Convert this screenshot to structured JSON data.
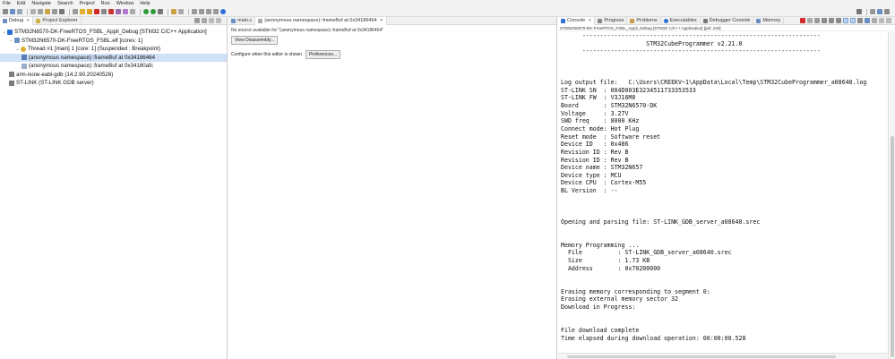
{
  "menu": [
    "File",
    "Edit",
    "Navigate",
    "Search",
    "Project",
    "Run",
    "Window",
    "Help"
  ],
  "left": {
    "tabs": [
      {
        "label": "Debug",
        "close": "✕"
      },
      {
        "label": "Project Explorer"
      }
    ],
    "tree": [
      "STM32N6570-DK-FreeRTOS_FSBL_Appli_Debug [STM32 C/C++ Application]",
      "STM32N6570-DK-FreeRTOS_FSBL.elf [cores: 1]",
      "Thread #1 [main] 1 [core: 1] (Suspended : Breakpoint)",
      "(anonymous namespace)::frameBuf at 0x34186464",
      "(anonymous namespace)::frameBuf at 0x34180afc",
      "arm-none-eabi-gdb (14.2.90.20240526)",
      "ST-LINK (ST-LINK GDB server)"
    ]
  },
  "editor": {
    "tabs": [
      {
        "label": "main.c"
      },
      {
        "label": "(anonymous namespace)::frameBuf at 0x34186464",
        "close": "✕"
      }
    ],
    "message": "No source available for \"(anonymous namespace)::frameBuf at 0x34186464\"",
    "view_disassembly": "View Disassembly...",
    "configure_text": "Configure when this editor is shown",
    "preferences": "Preferences..."
  },
  "console": {
    "tabs": [
      {
        "label": "Console",
        "close": "✕"
      },
      {
        "label": "Progress"
      },
      {
        "label": "Problems"
      },
      {
        "label": "Executables"
      },
      {
        "label": "Debugger Console"
      },
      {
        "label": "Memory"
      }
    ],
    "subtitle": "STM32N6570-DK-FreeRTOS_FSBL_Appli_Debug [STM32 C/C++ Application]  [pid: 104]",
    "lines": [
      "      -------------------------------------------------------------------",
      "                        STM32CubeProgrammer v2.21.0",
      "      -------------------------------------------------------------------",
      "",
      "",
      "",
      "Log output file:   C:\\Users\\CREEKV~1\\AppData\\Local\\Temp\\STM32CubeProgrammer_a08640.log",
      "ST-LINK SN  : 004D003E3234511733353533",
      "ST-LINK FW  : V3J16M8",
      "Board       : STM32N6570-DK",
      "Voltage     : 3.27V",
      "SWD freq    : 8000 KHz",
      "Connect mode: Hot Plug",
      "Reset mode  : Software reset",
      "Device ID   : 0x486",
      "Revision ID : Rev B",
      "Revision ID : Rev B",
      "Device name : STM32N657",
      "Device type : MCU",
      "Device CPU  : Cortex-M55",
      "BL Version  : --",
      "",
      "",
      "",
      "Opening and parsing file: ST-LINK_GDB_server_a08640.srec",
      "",
      "",
      "Memory Programming ...",
      "  File          : ST-LINK_GDB_server_a08640.srec",
      "  Size          : 1.73 KB",
      "  Address       : 0x70200000",
      "",
      "",
      "Erasing memory corresponding to segment 0:",
      "Erasing external memory sector 32",
      "Download in Progress:",
      "",
      "",
      "File download complete",
      "Time elapsed during download operation: 00:00:00.528"
    ]
  },
  "colors": {
    "accent_blue": "#2f6fd6",
    "selection": "#cfe0f7",
    "run_green": "#2e9b3a",
    "stop_red": "#d42a2a"
  }
}
